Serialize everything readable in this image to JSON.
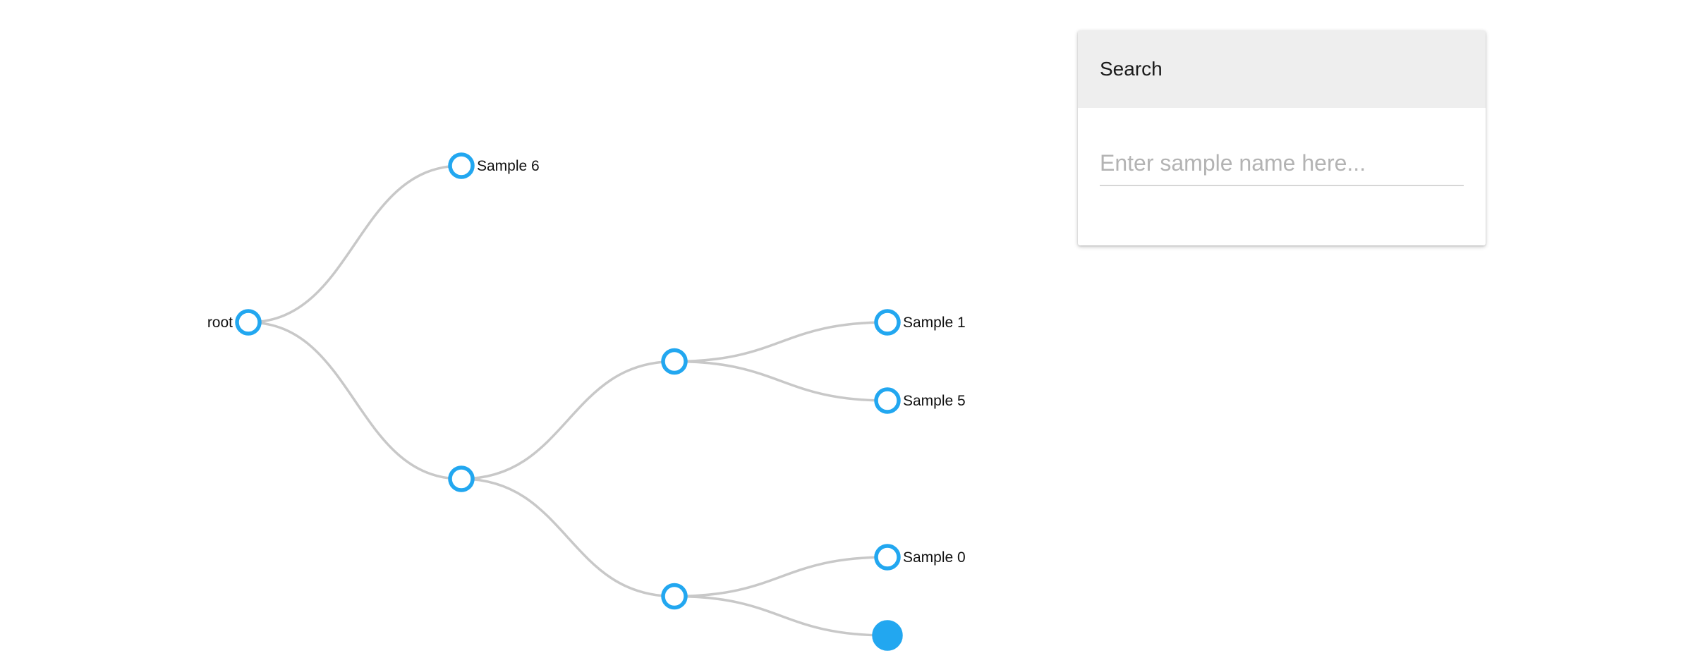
{
  "tree": {
    "accent_color": "#22a7f0",
    "link_color": "#c8c8c8",
    "nodes": [
      {
        "id": "root",
        "label": "root",
        "parent": null,
        "filled": false
      },
      {
        "id": "n6",
        "label": "Sample 6",
        "parent": "root",
        "filled": false
      },
      {
        "id": "a",
        "label": "",
        "parent": "root",
        "filled": false
      },
      {
        "id": "b",
        "label": "",
        "parent": "a",
        "filled": false
      },
      {
        "id": "c",
        "label": "",
        "parent": "a",
        "filled": false
      },
      {
        "id": "n1",
        "label": "Sample 1",
        "parent": "b",
        "filled": false
      },
      {
        "id": "n5",
        "label": "Sample 5",
        "parent": "b",
        "filled": false
      },
      {
        "id": "n0",
        "label": "Sample 0",
        "parent": "c",
        "filled": false
      },
      {
        "id": "leaf",
        "label": "",
        "parent": "c",
        "filled": true
      }
    ]
  },
  "search": {
    "title": "Search",
    "placeholder": "Enter sample name here...",
    "value": ""
  }
}
